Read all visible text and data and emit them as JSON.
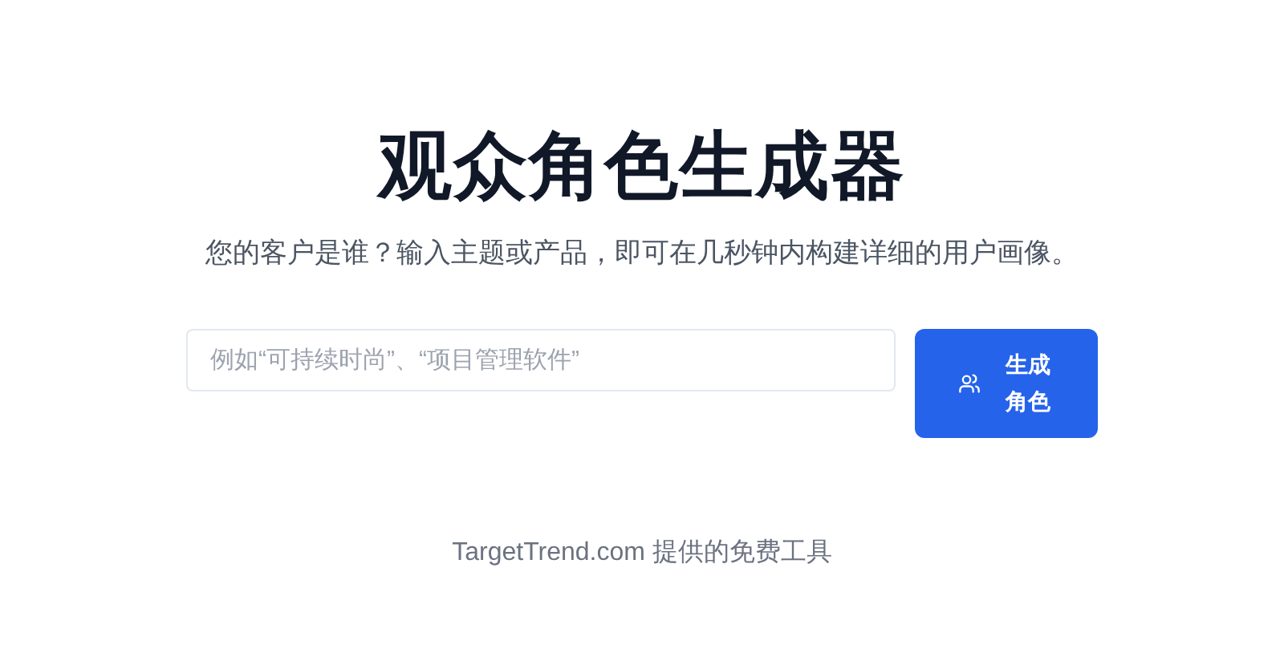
{
  "title": "观众角色生成器",
  "subtitle": "您的客户是谁？输入主题或产品，即可在几秒钟内构建详细的用户画像。",
  "search": {
    "placeholder": "例如“可持续时尚”、“项目管理软件”"
  },
  "button": {
    "label": "生成角色"
  },
  "footer": "TargetTrend.com 提供的免费工具"
}
